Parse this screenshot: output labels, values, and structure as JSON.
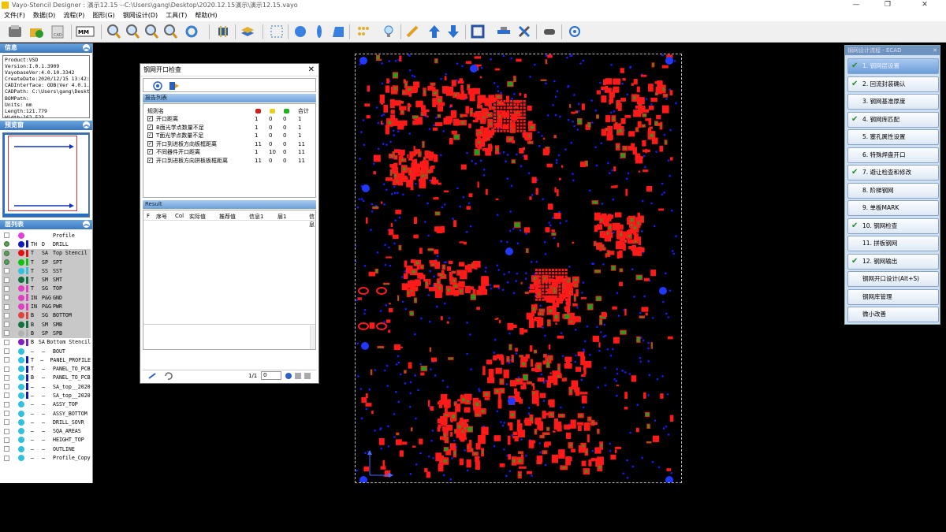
{
  "window": {
    "title": "Vayo-Stencil Designer : 演示12.15  --C:\\Users\\gang\\Desktop\\2020.12.15演示\\演示12.15.vayo",
    "minimize": "—",
    "maximize": "❐",
    "close": "✕"
  },
  "menu": [
    "文件(F)",
    "数据(D)",
    "流程(P)",
    "图形(G)",
    "钢网设计(D)",
    "工具(T)",
    "帮助(H)"
  ],
  "toolbar": {
    "unit_label": "MM",
    "icons": [
      "save-icon",
      "open-icon",
      "cad-icon",
      "mm-unit-icon",
      "zoom-in-icon",
      "zoom-out-icon",
      "zoom-window-icon",
      "zoom-fit-icon",
      "refresh-icon",
      "component-icon",
      "layer-icon",
      "select-icon",
      "circle-icon",
      "ellipse-icon",
      "quad-icon",
      "pad-icon",
      "bulb-icon",
      "pencil-icon",
      "arrow-up-icon",
      "arrow-down-icon",
      "rectangle-icon",
      "connect-icon",
      "tools-icon",
      "handshake-icon",
      "target-icon"
    ]
  },
  "left_panel": {
    "info_title": "信息",
    "info_lines": [
      "Product:VSD",
      "Version:I.0.1.3909",
      "VayobaseVer:4.0.10.3342",
      "CreateDate:2020/12/15 13:42:1",
      "CADInterface: ODB(Ver 4.0.1.1",
      "CADPath: C:\\Users\\gang\\Deskto",
      "BOMPath:",
      "Units: mm",
      "Length:121.779",
      "Width:162.523"
    ],
    "preview_title": "预览窗",
    "layers_title": "层列表",
    "layers": [
      {
        "t1": "",
        "t2": "",
        "name": "Profile",
        "c": "#e040e0",
        "bar": "",
        "on": false,
        "sel": false
      },
      {
        "t1": "TH",
        "t2": "D",
        "name": "DRILL",
        "c": "#1018c0",
        "bar": "#1018c0",
        "on": true,
        "sel": false
      },
      {
        "t1": "T",
        "t2": "SA",
        "name": "Top Stencil",
        "c": "#e01010",
        "bar": "#e01010",
        "on": true,
        "sel": true
      },
      {
        "t1": "T",
        "t2": "SP",
        "name": "SPT",
        "c": "#10c010",
        "bar": "#10c010",
        "on": true,
        "sel": true
      },
      {
        "t1": "T",
        "t2": "SS",
        "name": "SST",
        "c": "#30c0e0",
        "bar": "#30c0e0",
        "on": false,
        "sel": true
      },
      {
        "t1": "T",
        "t2": "SM",
        "name": "SMT",
        "c": "#107040",
        "bar": "#107040",
        "on": false,
        "sel": true
      },
      {
        "t1": "T",
        "t2": "SG",
        "name": "TOP",
        "c": "#e040c0",
        "bar": "#e040c0",
        "on": false,
        "sel": true
      },
      {
        "t1": "IN",
        "t2": "P&G",
        "name": "GND",
        "c": "#e040c0",
        "bar": "#e040c0",
        "on": false,
        "sel": true
      },
      {
        "t1": "IN",
        "t2": "P&G",
        "name": "PWR",
        "c": "#e040c0",
        "bar": "#e040c0",
        "on": false,
        "sel": true
      },
      {
        "t1": "B",
        "t2": "SG",
        "name": "BOTTOM",
        "c": "#e04040",
        "bar": "#e04040",
        "on": false,
        "sel": true
      },
      {
        "t1": "B",
        "t2": "SM",
        "name": "SMB",
        "c": "#107040",
        "bar": "#107040",
        "on": false,
        "sel": true
      },
      {
        "t1": "B",
        "t2": "SP",
        "name": "SPB",
        "c": "#b0b0b0",
        "bar": "#b0b0b0",
        "on": false,
        "sel": true
      },
      {
        "t1": "B",
        "t2": "SA",
        "name": "Bottom Stencil",
        "c": "#8020c0",
        "bar": "#8020c0",
        "on": false,
        "sel": false
      },
      {
        "t1": "—",
        "t2": "—",
        "name": "BOUT",
        "c": "#30c0e0",
        "bar": "",
        "on": false,
        "sel": false
      },
      {
        "t1": "T",
        "t2": "—",
        "name": "PANEL_PROFILE",
        "c": "#30c0e0",
        "bar": "#1018c0",
        "on": false,
        "sel": false
      },
      {
        "t1": "T",
        "t2": "—",
        "name": "PANEL_TO_PCB",
        "c": "#30c0e0",
        "bar": "#1018c0",
        "on": false,
        "sel": false
      },
      {
        "t1": "B",
        "t2": "—",
        "name": "PANEL_TO_PCB",
        "c": "#30c0e0",
        "bar": "#1018c0",
        "on": false,
        "sel": false
      },
      {
        "t1": "—",
        "t2": "—",
        "name": "SA_top__2020",
        "c": "#30c0e0",
        "bar": "#1018c0",
        "on": false,
        "sel": false
      },
      {
        "t1": "—",
        "t2": "—",
        "name": "SA_top__2020",
        "c": "#30c0e0",
        "bar": "#1018c0",
        "on": false,
        "sel": false
      },
      {
        "t1": "—",
        "t2": "—",
        "name": "ASSY_TOP",
        "c": "#30c0e0",
        "bar": "",
        "on": false,
        "sel": false
      },
      {
        "t1": "—",
        "t2": "—",
        "name": "ASSY_BOTTOM",
        "c": "#30c0e0",
        "bar": "",
        "on": false,
        "sel": false
      },
      {
        "t1": "—",
        "t2": "—",
        "name": "DRILL_SOVR",
        "c": "#30c0e0",
        "bar": "",
        "on": false,
        "sel": false
      },
      {
        "t1": "—",
        "t2": "—",
        "name": "SQA_AREAS",
        "c": "#30c0e0",
        "bar": "",
        "on": false,
        "sel": false
      },
      {
        "t1": "—",
        "t2": "—",
        "name": "HEIGHT_TOP",
        "c": "#30c0e0",
        "bar": "",
        "on": false,
        "sel": false
      },
      {
        "t1": "—",
        "t2": "—",
        "name": "OUTLINE",
        "c": "#30c0e0",
        "bar": "",
        "on": false,
        "sel": false
      },
      {
        "t1": "—",
        "t2": "—",
        "name": "Profile_Copy",
        "c": "#30c0e0",
        "bar": "",
        "on": false,
        "sel": false
      }
    ]
  },
  "dialog": {
    "title": "钢网开口检查",
    "close": "✕",
    "report_header": "报告列表",
    "columns": {
      "rule": "规则名",
      "total": "合计"
    },
    "status_colors": [
      "#d02020",
      "#e8d020",
      "#20b020"
    ],
    "rules": [
      {
        "name": "开口距离",
        "c1": "1",
        "c2": "0",
        "c3": "0",
        "total": "1"
      },
      {
        "name": "B面光学点数量不足",
        "c1": "1",
        "c2": "0",
        "c3": "0",
        "total": "1"
      },
      {
        "name": "T面光学点数量不足",
        "c1": "1",
        "c2": "0",
        "c3": "0",
        "total": "1"
      },
      {
        "name": "开口到进板方向板框距离",
        "c1": "11",
        "c2": "0",
        "c3": "0",
        "total": "11"
      },
      {
        "name": "不同器件开口距离",
        "c1": "1",
        "c2": "10",
        "c3": "0",
        "total": "11"
      },
      {
        "name": "开口到进板方向拼板板框距离",
        "c1": "11",
        "c2": "0",
        "c3": "0",
        "total": "11"
      }
    ],
    "result_header": "Result",
    "result_cols": [
      "F",
      "序号",
      "Col",
      "实际值",
      "推荐值",
      "信息1",
      "层1",
      "信息"
    ],
    "page": "1/1",
    "page_input": "0"
  },
  "flow": {
    "title": "钢网设计流程 - ECAD",
    "close": "✕",
    "steps": [
      {
        "label": "1.  钢网层设置",
        "check": true,
        "active": true
      },
      {
        "label": "2.  回流封装确认",
        "check": true,
        "active": false
      },
      {
        "label": "3.  钢网基准厚度",
        "check": false,
        "active": false
      },
      {
        "label": "4.  钢网库匹配",
        "check": true,
        "active": false
      },
      {
        "label": "5.  塞孔属性设置",
        "check": false,
        "active": false
      },
      {
        "label": "6.  特殊焊盘开口",
        "check": false,
        "active": false
      },
      {
        "label": "7.  避让检查和修改",
        "check": true,
        "active": false
      },
      {
        "label": "8.  阶梯钢网",
        "check": false,
        "active": false
      },
      {
        "label": "9.  单板MARK",
        "check": false,
        "active": false
      },
      {
        "label": "10.  钢网检查",
        "check": true,
        "active": false
      },
      {
        "label": "11.  拼板钢网",
        "check": false,
        "active": false
      },
      {
        "label": "12.  钢网输出",
        "check": true,
        "active": false
      },
      {
        "label": "钢网开口设计(Alt+S)",
        "check": false,
        "active": false
      },
      {
        "label": "钢网库管理",
        "check": false,
        "active": false
      },
      {
        "label": "微小改善",
        "check": false,
        "active": false
      }
    ],
    "checkmark": "✔"
  },
  "canvas": {
    "axis_x": "X",
    "axis_y": "Y",
    "colors": {
      "pad": "#ff1a1a",
      "paste": "#1fa01f",
      "via": "#1a1aff",
      "fiducial": "#2238ff"
    }
  }
}
